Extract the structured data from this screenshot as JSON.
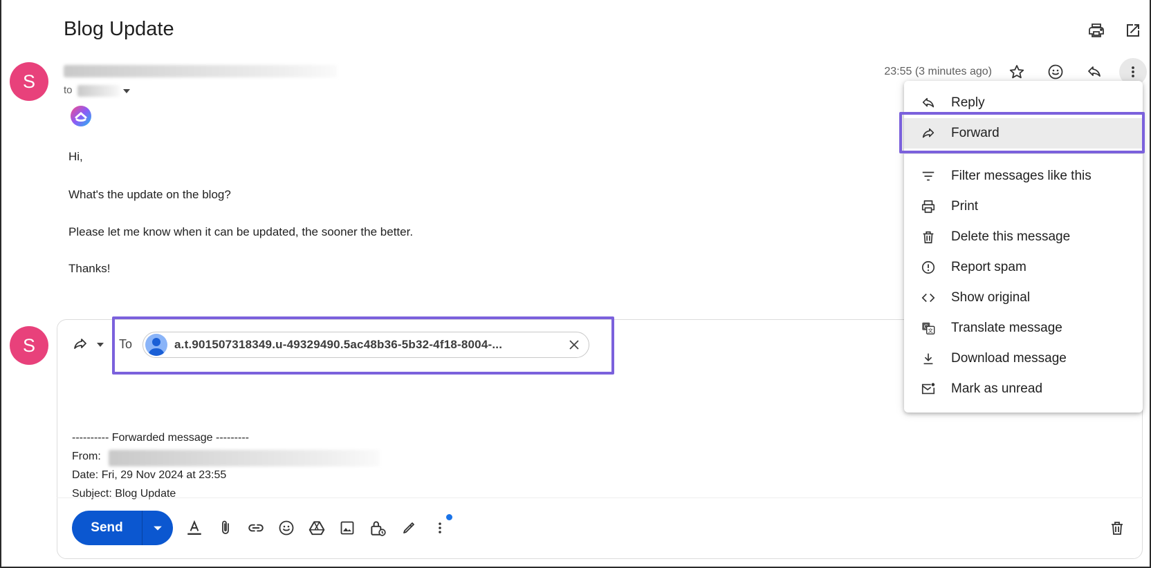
{
  "email": {
    "subject": "Blog Update",
    "sender_initial": "S",
    "to_prefix": "to",
    "time": "23:55 (3 minutes ago)",
    "body": {
      "greeting": "Hi,",
      "line1": "What's the update on the blog?",
      "line2": "Please let me know when it can be updated, the sooner the better.",
      "closing": "Thanks!"
    }
  },
  "compose": {
    "sender_initial": "S",
    "to_label": "To",
    "recipient": "a.t.901507318349.u-49329490.5ac48b36-5b32-4f18-8004-...",
    "forwarded_header": "---------- Forwarded message ---------",
    "from_label": "From:",
    "date_line": "Date: Fri, 29 Nov 2024 at 23:55",
    "subject_line": "Subject: Blog Update",
    "send_label": "Send"
  },
  "menu": {
    "items": [
      {
        "label": "Reply",
        "icon": "reply-icon"
      },
      {
        "label": "Forward",
        "icon": "forward-icon"
      },
      {
        "label": "Filter messages like this",
        "icon": "filter-icon"
      },
      {
        "label": "Print",
        "icon": "print-icon"
      },
      {
        "label": "Delete this message",
        "icon": "trash-icon"
      },
      {
        "label": "Report spam",
        "icon": "spam-icon"
      },
      {
        "label": "Show original",
        "icon": "code-icon"
      },
      {
        "label": "Translate message",
        "icon": "translate-icon"
      },
      {
        "label": "Download message",
        "icon": "download-icon"
      },
      {
        "label": "Mark as unread",
        "icon": "mark-unread-icon"
      }
    ]
  },
  "colors": {
    "avatar": "#e8417b",
    "send": "#0b57d0",
    "highlight_box": "#7b61dc"
  }
}
